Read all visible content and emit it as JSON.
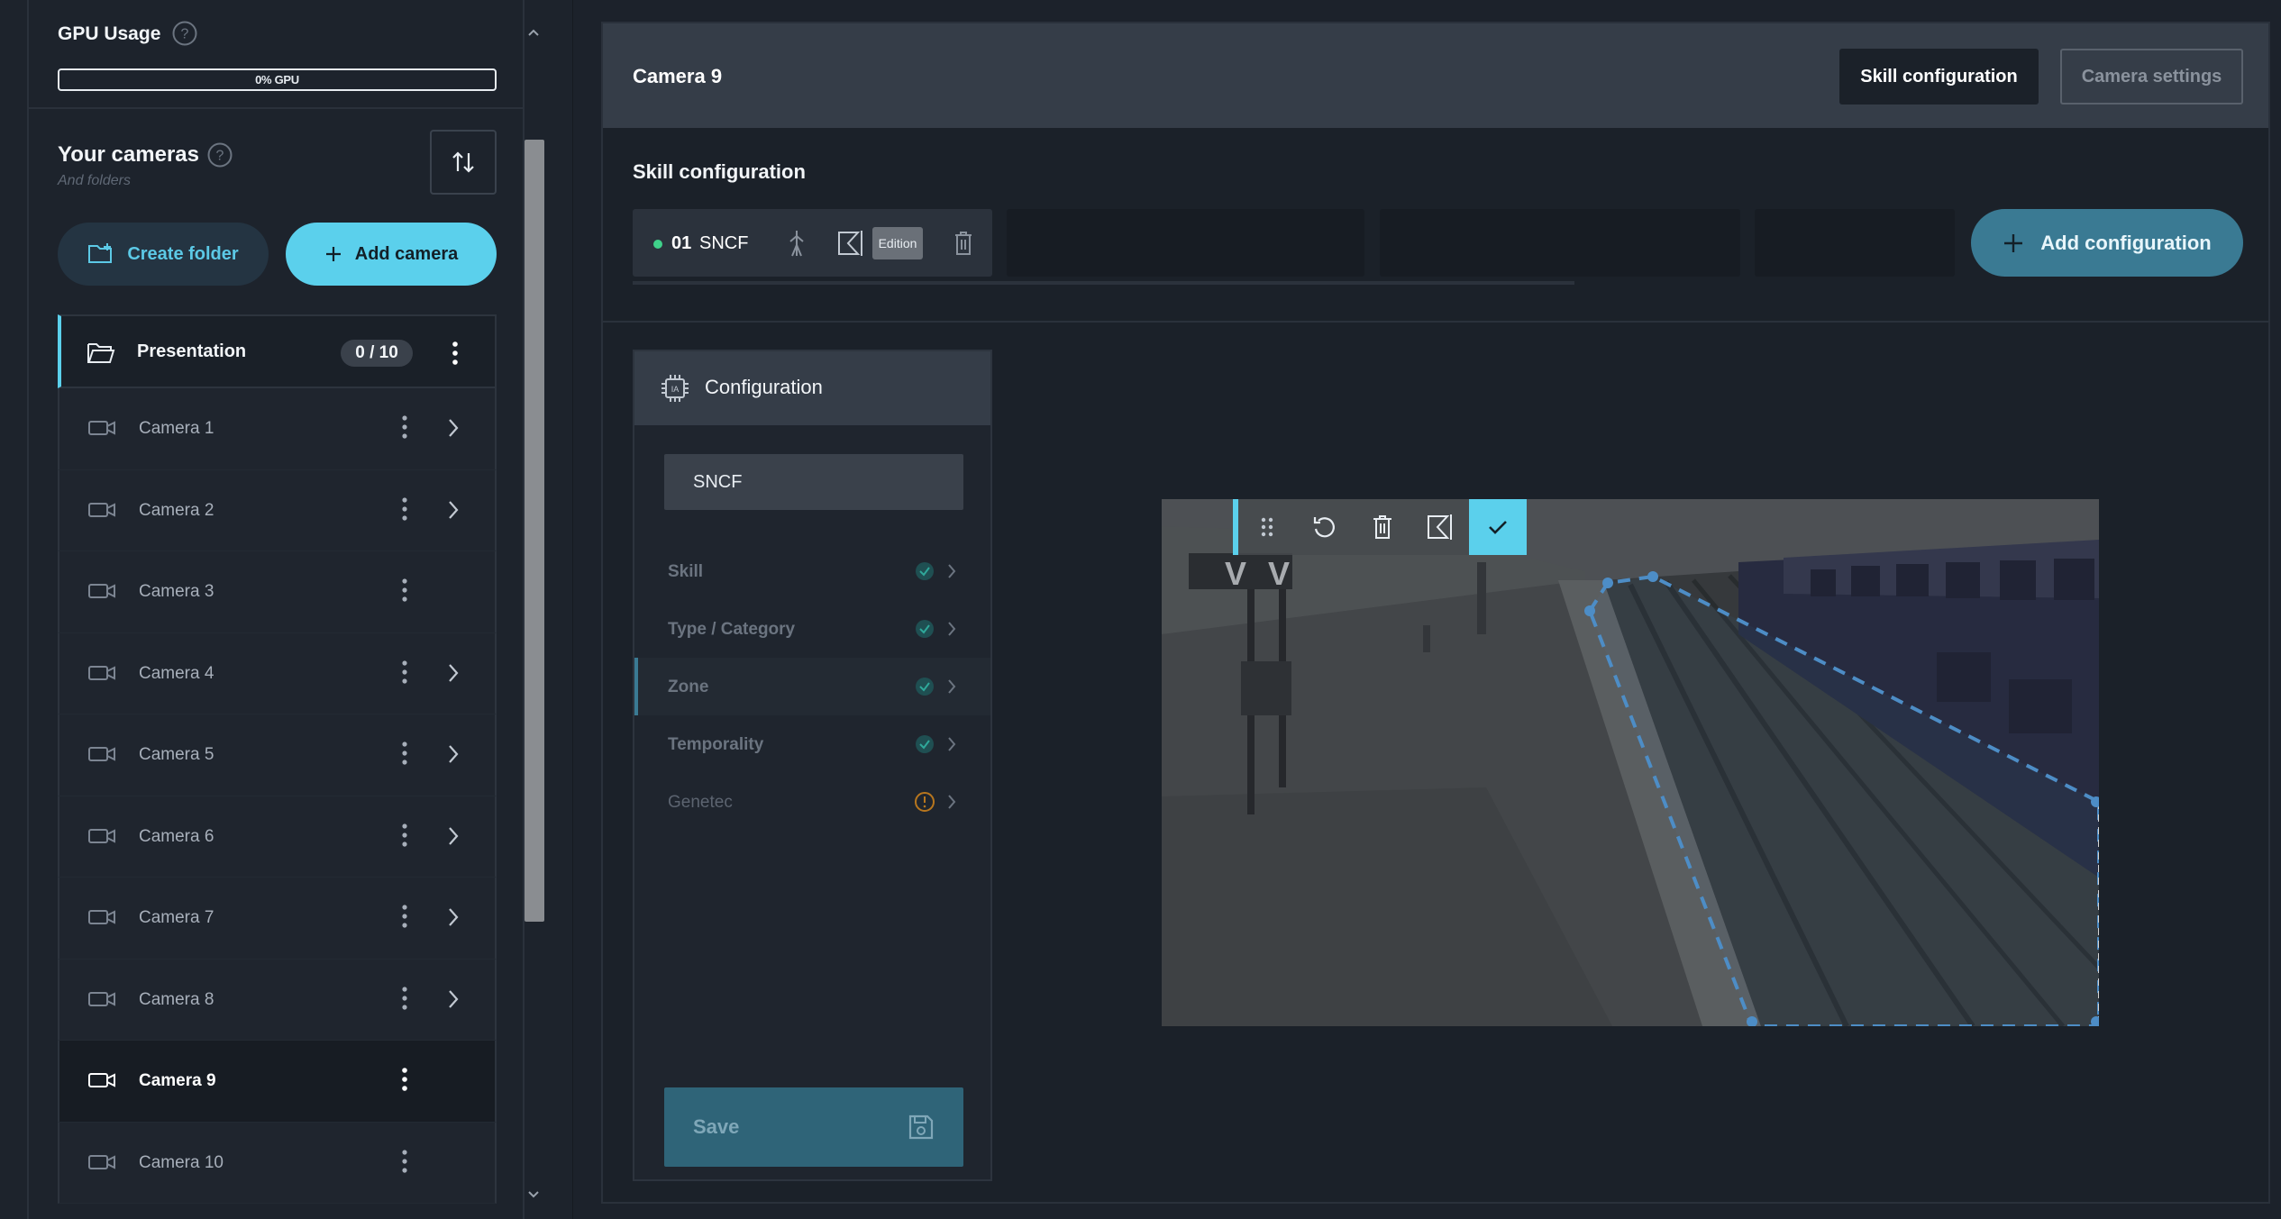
{
  "sidebar": {
    "gpu": {
      "title": "GPU Usage",
      "bar_label": "0% GPU",
      "percent": 0
    },
    "cameras_header": {
      "title": "Your cameras",
      "subtitle": "And folders"
    },
    "buttons": {
      "create_folder": "Create folder",
      "add_camera": "Add camera"
    },
    "folder": {
      "label": "Presentation",
      "count": "0 / 10"
    },
    "cameras": [
      {
        "label": "Camera 1",
        "has_chevron": true,
        "active": false
      },
      {
        "label": "Camera 2",
        "has_chevron": true,
        "active": false
      },
      {
        "label": "Camera 3",
        "has_chevron": false,
        "active": false
      },
      {
        "label": "Camera 4",
        "has_chevron": true,
        "active": false
      },
      {
        "label": "Camera 5",
        "has_chevron": true,
        "active": false
      },
      {
        "label": "Camera 6",
        "has_chevron": true,
        "active": false
      },
      {
        "label": "Camera 7",
        "has_chevron": true,
        "active": false
      },
      {
        "label": "Camera 8",
        "has_chevron": true,
        "active": false
      },
      {
        "label": "Camera 9",
        "has_chevron": false,
        "active": true
      },
      {
        "label": "Camera 10",
        "has_chevron": false,
        "active": false
      }
    ]
  },
  "main": {
    "title": "Camera 9",
    "tabs": {
      "skill_configuration": "Skill configuration",
      "camera_settings": "Camera settings"
    },
    "skill_section_title": "Skill configuration",
    "skill_chip": {
      "number": "01",
      "name": "SNCF",
      "badge": "Edition"
    },
    "add_configuration": "Add configuration",
    "config_panel": {
      "title": "Configuration",
      "name_value": "SNCF",
      "steps": [
        {
          "label": "Skill",
          "status": "done"
        },
        {
          "label": "Type / Category",
          "status": "done"
        },
        {
          "label": "Zone",
          "status": "done"
        },
        {
          "label": "Temporality",
          "status": "done"
        },
        {
          "label": "Genetec",
          "status": "warning"
        }
      ],
      "save_label": "Save"
    }
  },
  "colors": {
    "accent": "#5bd0ec",
    "accent_dark": "#3a7a93",
    "status_done": "#1f6b6a",
    "status_warning": "#d28a2a",
    "zone_line": "#5aa8ec"
  }
}
